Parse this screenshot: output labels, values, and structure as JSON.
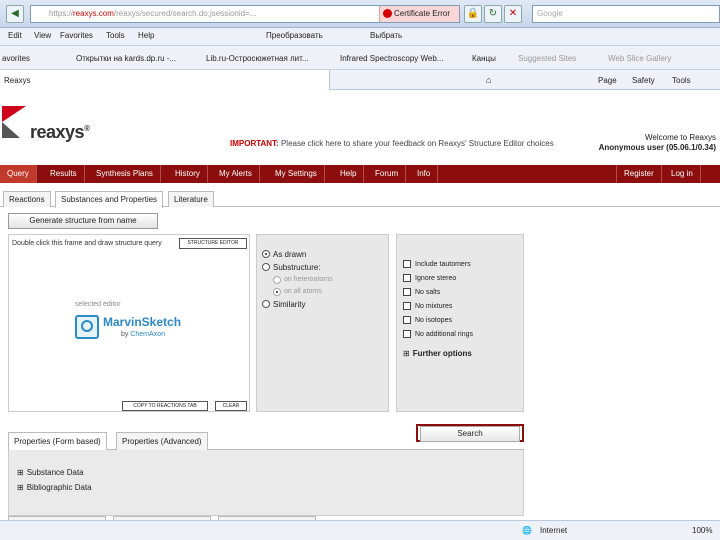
{
  "browser": {
    "url_scheme": "https://",
    "url_host_bold": "reaxys.com",
    "url_rest": "/reaxys/secured/search.do;jsessionid=...",
    "cert_error": "Certificate Error",
    "google_placeholder": "Google",
    "menu": [
      "Edit",
      "View",
      "Favorites",
      "Tools",
      "Help"
    ],
    "translate": "Преобразовать",
    "select": "Выбрать",
    "favorites_label": "avorites",
    "favorites": [
      "Открытки на kards.dp.ru -...",
      "Lib.ru-Остросюжетная лит...",
      "Infrared Spectroscopy Web...",
      "Канцы",
      "Suggested Sites",
      "Web Slice Gallery"
    ],
    "tab_title": "Reaxys",
    "cmd_items": [
      "Page",
      "Safety",
      "Tools"
    ],
    "status_zone": "Internet",
    "zoom": "100%"
  },
  "header": {
    "logo_text": "reaxys",
    "logo_mark": "®",
    "notice_bold": "IMPORTANT:",
    "notice_rest": " Please click here to share your feedback on Reaxys' Structure Editor choices",
    "welcome": "Welcome to Reaxys",
    "user": "Anonymous user (05.06.1/0.34)"
  },
  "nav": {
    "items": [
      "Query",
      "Results",
      "Synthesis Plans",
      "History",
      "My Alerts",
      "My Settings",
      "Help",
      "Forum",
      "Info"
    ],
    "right": [
      "Register",
      "Log in"
    ]
  },
  "subtabs": [
    "Reactions",
    "Substances and Properties",
    "Literature"
  ],
  "editor": {
    "generate_label": "Generate structure from name",
    "hint": "Double click this frame and draw structure query",
    "struct_editor_btn": "STRUCTURE EDITOR",
    "selected_editor": "selected editor",
    "product": "MarvinSketch",
    "by": "by ",
    "vendor": "ChemAxon",
    "copy_btn": "COPY TO REACTIONS TAB",
    "clear_btn": "CLEAR"
  },
  "search_type": {
    "as_drawn": "As drawn",
    "substructure": "Substructure:",
    "on_heteroatoms": "on heteroatoms",
    "on_all_atoms": "on all atoms",
    "similarity": "Similarity"
  },
  "options": {
    "items": [
      "Include tautomers",
      "Ignore stereo",
      "No salts",
      "No mixtures",
      "No isotopes",
      "No additional rings"
    ],
    "further": "Further options"
  },
  "search_label": "Search",
  "properties": {
    "tabs": [
      "Properties (Form based)",
      "Properties (Advanced)"
    ],
    "rows": [
      "Substance Data",
      "Bibliographic Data"
    ]
  }
}
